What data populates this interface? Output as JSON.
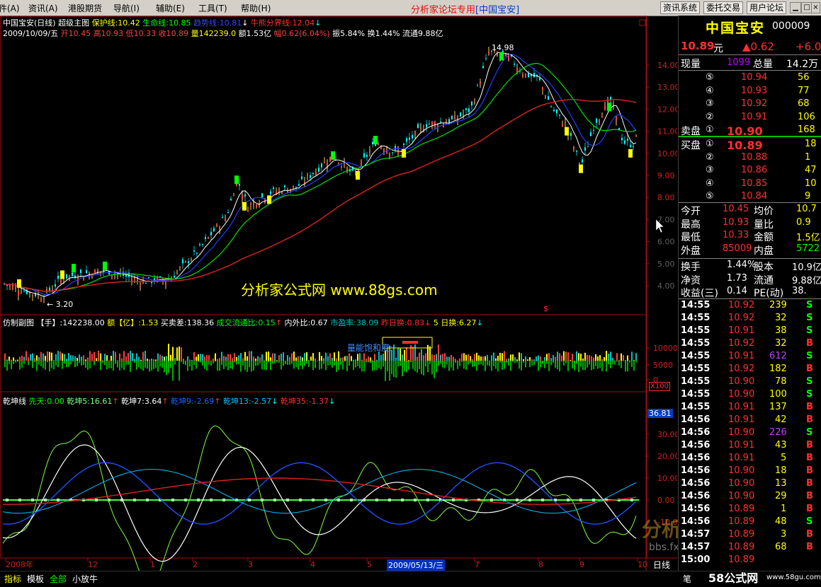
{
  "menubar": {
    "items": [
      "件(A)",
      "资讯(A)",
      "港股期货",
      "导航(I)",
      "辅助(E)",
      "工具(T)",
      "帮助(H)"
    ],
    "title": "分析家论坛专用",
    "title_em": "[中国宝安]",
    "buttons": [
      "资讯系统",
      "委托交易",
      "用户论坛"
    ],
    "win_min": "▁",
    "win_max": "□",
    "win_close": "×"
  },
  "main_chart": {
    "info_line1": {
      "name": "中国宝安(日线)",
      "type": "超级主图",
      "bao_hu": "保护线:10.42",
      "sheng_ming": "生命线:10.85",
      "chao_shi": "趋势线:10.81",
      "niu_xiong": "牛熊分界线:12.04"
    },
    "info_line2": {
      "date": "2009/10/09/五",
      "open": "开10.45",
      "high": "高10.93",
      "low": "低10.33",
      "close": "收10.89",
      "vol": "量142239.0",
      "amount": "额1.53亿",
      "change": "幅0.62(6.04%)",
      "amplitude": "振5.84%",
      "turnover": "换1.44%",
      "float": "流通9.88亿"
    },
    "y_ticks": [
      "14.00",
      "13.00",
      "12.00",
      "11.00",
      "10.00",
      "9.00",
      "8.00",
      "7.00",
      "6.00",
      "5.00",
      "4.00"
    ],
    "high_label": "14.98",
    "low_label": "3.20",
    "watermark": "分析家公式网 www.88gs.com",
    "s_marker": "$"
  },
  "vol_panel": {
    "title": "仿制副图",
    "hand": "【手】:142238.00",
    "amount": "额【亿】:1.53",
    "buy_sell": "买卖差:138.36",
    "turnover_ratio": "成交流通比:0.15",
    "inout": "内外比:0.67",
    "pe": "市盈率:38.09",
    "yest": "昨日换:0.83",
    "five": "5 日换:6.27",
    "y_ticks": [
      "10000",
      "5000",
      "0"
    ],
    "unit": "X100",
    "saturation": "量能饱和度:"
  },
  "qk_panel": {
    "title": "乾坤线",
    "xian_tian": "先天:0.00",
    "qk5": "乾坤5:16.61",
    "qk7": "乾坤7:3.64",
    "qk9": "乾坤9:-2.69",
    "qk13": "乾坤13:-2.57",
    "qk35": "乾坤35:-1.37",
    "current": "36.81",
    "y_ticks": [
      "30.00",
      "20.00",
      "10.00",
      "0.00",
      "-10.00"
    ]
  },
  "x_axis": {
    "labels": [
      "2008年",
      "12",
      "1",
      "2",
      "3",
      "4",
      "5",
      "7",
      "8",
      "9",
      "10"
    ],
    "cursor_date": "2009/05/13/三",
    "period": "日线"
  },
  "quote": {
    "name": "中国宝安",
    "code": "000009",
    "price": "10.89",
    "unit": "元",
    "change": "▲0.62",
    "change_pct": "+6.0",
    "now_vol_label": "现量",
    "now_vol": "1099",
    "total_label": "总量",
    "total": "14.2万",
    "sell_label": "卖盘",
    "buy_label": "买盘",
    "sells": [
      {
        "lvl": "⑤",
        "price": "10.94",
        "vol": "56"
      },
      {
        "lvl": "④",
        "price": "10.93",
        "vol": "77"
      },
      {
        "lvl": "③",
        "price": "10.92",
        "vol": "68"
      },
      {
        "lvl": "②",
        "price": "10.91",
        "vol": "106"
      },
      {
        "lvl": "①",
        "price": "10.90",
        "vol": "168"
      }
    ],
    "buys": [
      {
        "lvl": "①",
        "price": "10.89",
        "vol": "18"
      },
      {
        "lvl": "②",
        "price": "10.88",
        "vol": "1"
      },
      {
        "lvl": "③",
        "price": "10.86",
        "vol": "47"
      },
      {
        "lvl": "④",
        "price": "10.85",
        "vol": "10"
      },
      {
        "lvl": "⑤",
        "price": "10.84",
        "vol": "9"
      }
    ],
    "stats": [
      {
        "l1": "今开",
        "v1": "10.45",
        "l2": "均价",
        "v2": "10.7"
      },
      {
        "l1": "最高",
        "v1": "10.93",
        "l2": "量比",
        "v2": "0.9"
      },
      {
        "l1": "最低",
        "v1": "10.33",
        "l2": "金额",
        "v2": "1.5亿"
      },
      {
        "l1": "外盘",
        "v1": "85009",
        "l2": "内盘",
        "v2": "5722"
      }
    ],
    "stats2": [
      {
        "l1": "换手",
        "v1": "1.44%",
        "l2": "股本",
        "v2": "10.9亿"
      },
      {
        "l1": "净资",
        "v1": "1.73",
        "l2": "流通",
        "v2": "9.88亿"
      },
      {
        "l1": "收益(三)",
        "v1": "0.14",
        "l2": "PE(动)",
        "v2": "38."
      }
    ],
    "ticks": [
      {
        "t": "14:55",
        "p": "10.92",
        "v": "239",
        "s": "S"
      },
      {
        "t": "14:55",
        "p": "10.92",
        "v": "32",
        "s": "S"
      },
      {
        "t": "14:55",
        "p": "10.91",
        "v": "38",
        "s": "S"
      },
      {
        "t": "14:55",
        "p": "10.92",
        "v": "32",
        "s": "B"
      },
      {
        "t": "14:55",
        "p": "10.91",
        "v": "612",
        "s": "S"
      },
      {
        "t": "14:55",
        "p": "10.92",
        "v": "182",
        "s": "B"
      },
      {
        "t": "14:55",
        "p": "10.90",
        "v": "78",
        "s": "S"
      },
      {
        "t": "14:55",
        "p": "10.90",
        "v": "100",
        "s": "S"
      },
      {
        "t": "14:55",
        "p": "10.91",
        "v": "137",
        "s": "B"
      },
      {
        "t": "14:56",
        "p": "10.91",
        "v": "42",
        "s": "B"
      },
      {
        "t": "14:56",
        "p": "10.90",
        "v": "226",
        "s": "S"
      },
      {
        "t": "14:56",
        "p": "10.91",
        "v": "43",
        "s": "B"
      },
      {
        "t": "14:56",
        "p": "10.91",
        "v": "5",
        "s": "B"
      },
      {
        "t": "14:56",
        "p": "10.90",
        "v": "18",
        "s": "B"
      },
      {
        "t": "14:56",
        "p": "10.90",
        "v": "13",
        "s": "B"
      },
      {
        "t": "14:56",
        "p": "10.90",
        "v": "29",
        "s": "B"
      },
      {
        "t": "14:56",
        "p": "10.89",
        "v": "1",
        "s": "B"
      },
      {
        "t": "14:56",
        "p": "10.89",
        "v": "48",
        "s": "S"
      },
      {
        "t": "14:57",
        "p": "10.89",
        "v": "3",
        "s": "B"
      },
      {
        "t": "14:57",
        "p": "10.89",
        "v": "68",
        "s": "B"
      },
      {
        "t": "15:00",
        "p": "10.89",
        "v": "",
        "s": ""
      }
    ]
  },
  "bottom": {
    "tabs": [
      "指标",
      "模板",
      "全部",
      "小放牛"
    ],
    "right_label": "笔",
    "logo": "58公式网",
    "logo_url": "www.58gu.com"
  },
  "watermark2": "分析家论坛",
  "watermark2_url": "bbs.fxjgs.com"
}
